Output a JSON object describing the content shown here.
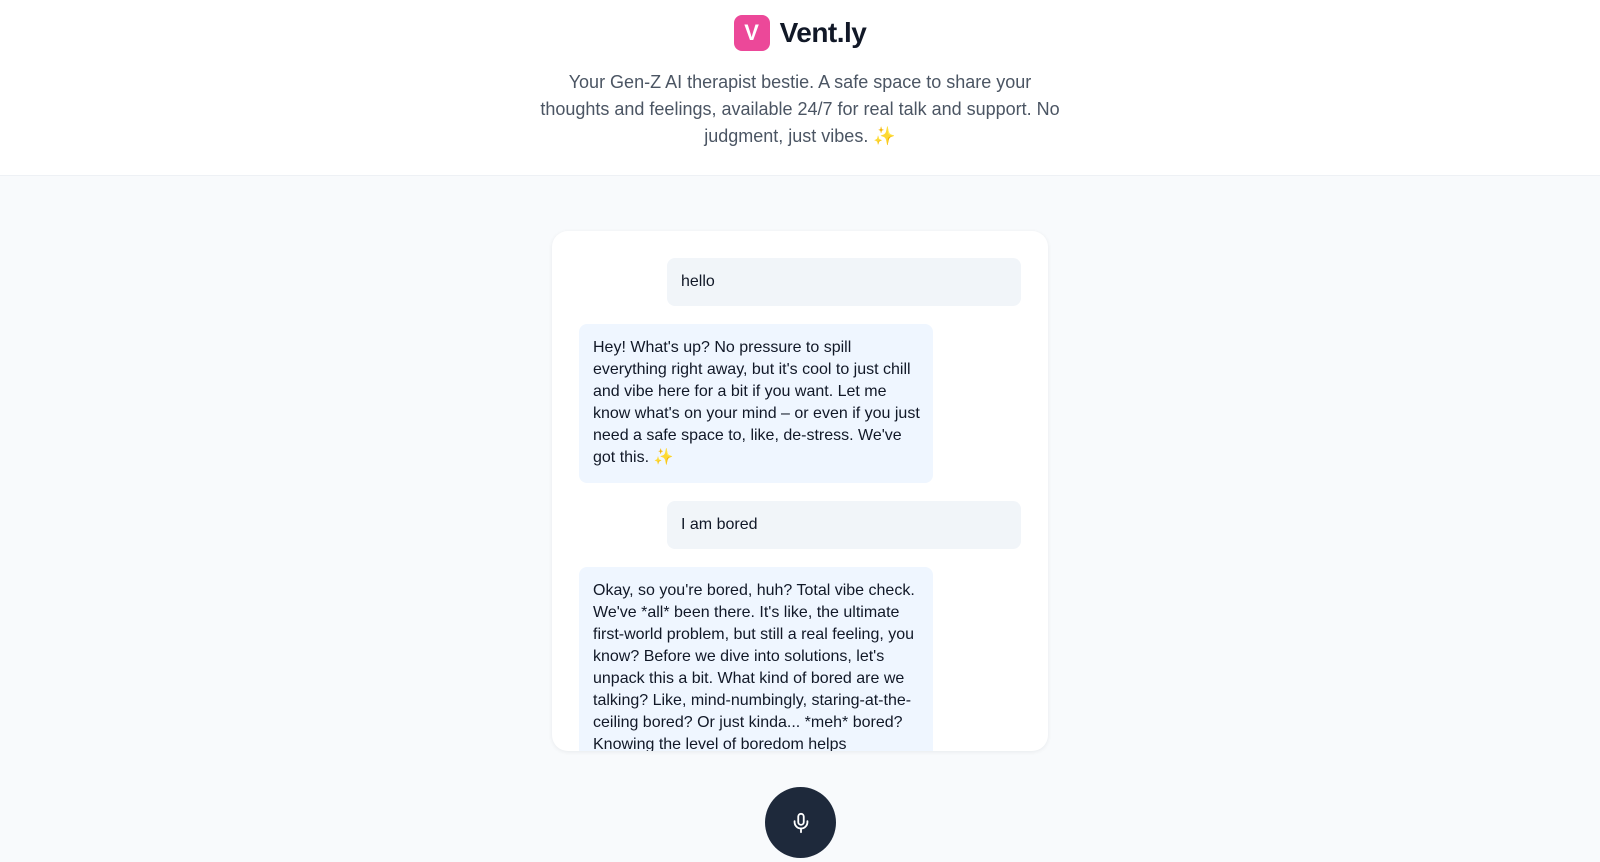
{
  "brand": {
    "logo_letter": "V",
    "name": "Vent.ly",
    "logo_color": "#ec4899"
  },
  "tagline": "Your Gen-Z AI therapist bestie. A safe space to share your thoughts and feelings, available 24/7 for real talk and support. No judgment, just vibes.",
  "tagline_emoji": "✨",
  "chat": {
    "messages": [
      {
        "role": "user",
        "text": "hello"
      },
      {
        "role": "assistant",
        "text": "Hey! What's up? No pressure to spill everything right away, but it's cool to just chill and vibe here for a bit if you want. Let me know what's on your mind – or even if you just need a safe space to, like, de-stress. We've got this.",
        "emoji": "✨"
      },
      {
        "role": "user",
        "text": "I am bored"
      },
      {
        "role": "assistant",
        "text": "Okay, so you're bored, huh? Total vibe check. We've *all* been there. It's like, the ultimate first-world problem, but still a real feeling, you know? Before we dive into solutions, let's unpack this a bit. What kind of bored are we talking? Like, mind-numbingly, staring-at-the-ceiling bored? Or just kinda... *meh* bored? Knowing the level of boredom helps"
      }
    ]
  },
  "mic": {
    "icon": "microphone-icon",
    "color": "#1e293b"
  }
}
